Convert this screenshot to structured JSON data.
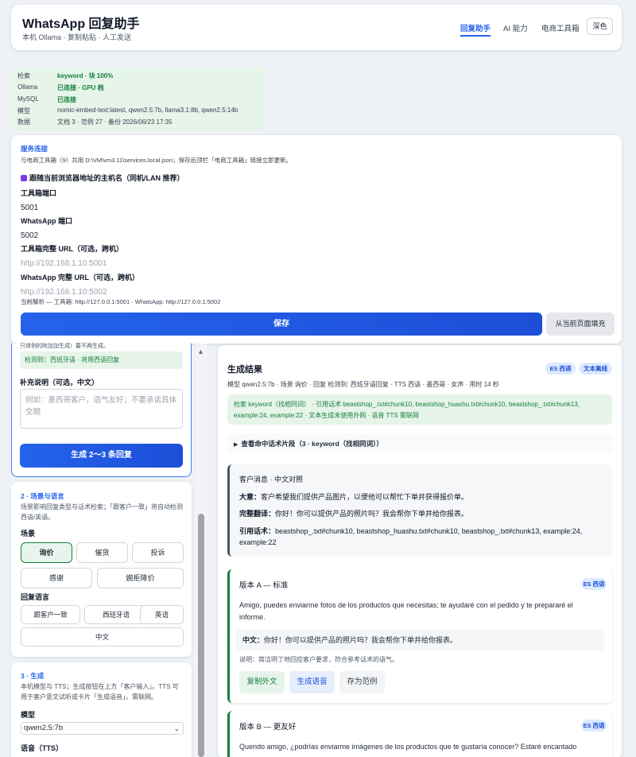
{
  "header": {
    "title": "WhatsApp 回复助手",
    "subtitle": "本机 Ollama · 复制粘贴 · 人工发送",
    "nav": [
      "回复助手",
      "AI 能力",
      "电商工具箱"
    ],
    "theme_button": "深色"
  },
  "status": {
    "rows": [
      {
        "key": "检索",
        "val": "keyword · 块 100%"
      },
      {
        "key": "Ollama",
        "val": "已连接 · GPU 档"
      },
      {
        "key": "MySQL",
        "val": "已连接"
      },
      {
        "key": "模型",
        "val": "nomic-embed-text:latest, qwen2.5:7b, llama3.1:8b, qwen2.5:14b"
      },
      {
        "key": "数据",
        "val": "文档 3 · 范例 27 · 备份 2026/06/23 17:35"
      }
    ]
  },
  "service": {
    "title": "服务连接",
    "note": "与电商工具箱（9）共用 D:\\VM\\vm3.11\\services.local.json；保存后顶栏「电商工具箱」链接立即更新。",
    "checkbox_label": "跟随当前浏览器地址的主机名（同机/LAN 推荐）",
    "toolbox_port_label": "工具箱端口",
    "toolbox_port": "5001",
    "wa_port_label": "WhatsApp 端口",
    "wa_port": "5002",
    "toolbox_url_label": "工具箱完整 URL（可选，跨机）",
    "toolbox_url_placeholder": "http://192.168.1.10:5001",
    "wa_url_label": "WhatsApp 完整 URL（可选，跨机）",
    "wa_url_placeholder": "http://192.168.1.10:5002",
    "resolved": "当前解析 — 工具箱: http://127.0.0.1:5001 · WhatsApp: http://127.0.0.1:5002",
    "save_label": "保存",
    "fill_label": "从当前页面填充"
  },
  "panel1": {
    "clipped_text": "只体例的附加加生成）要不两生成。",
    "detected": "检测到：西班牙语 · 将用西语回复",
    "note_label": "补充说明（可选，中文）",
    "note_placeholder": "例如：墨西哥客户，语气友好；不要承诺具体交期",
    "generate_label": "生成 2〜3 条回复"
  },
  "panel2": {
    "title": "2 · 场景与语言",
    "desc": "场景影响回复类型与话术检索；「跟客户一致」将自动检测西语/英语。",
    "scene_label": "场景",
    "scenes": [
      "询价",
      "催货",
      "投诉",
      "感谢",
      "婉拒降价"
    ],
    "lang_label": "回复语言",
    "langs": [
      "跟客户一致",
      "西班牙语",
      "英语",
      "中文"
    ]
  },
  "panel3": {
    "title": "3 · 生成",
    "desc": "本机模型与 TTS；生成按钮在上方「客户输入」。TTS 可用于客户意文试听或卡片「生成语音」，需联网。",
    "model_label": "模型",
    "model_value": "qwen2.5:7b",
    "tts_label": "语音（TTS）"
  },
  "results": {
    "title": "生成结果",
    "badges": [
      "ES 西语",
      "文本离线"
    ],
    "meta": "模型 qwen2.5:7b · 场景 询价 · 回复 检测到: 西班牙语回复 · TTS 西语 · 墨西哥 · 女声 · 用时 14 秒",
    "ref_line1": "检索 keyword（找相同词） · 引用话术 beastshop_.txt#chunk10, beastshop_huashu.txt#chunk10, beastshop_.txt#chunk13,",
    "ref_line2": "example:24, example:22 · 文本生成未使用外网 · 语音 TTS 需联网",
    "snippets": "查看命中话术片段（3 · keyword（找相同词））",
    "customer": {
      "title": "客户消息 · 中文对照",
      "gist_label": "大意：",
      "gist": "客户希望我们提供产品图片，以便他可以帮忙下单并获得报价单。",
      "trans_label": "完整翻译：",
      "trans": "你好！你可以提供产品的照片吗？我会帮你下单并给你报表。",
      "cited_label": "引用话术：",
      "cited1": "beastshop_.txt#chunk10, beastshop_huashu.txt#chunk10, beastshop_.txt#chunk13, example:24,",
      "cited2": "example:22"
    },
    "versionA": {
      "title": "版本 A — 标准",
      "badge": "ES 西语",
      "text1": "Amigo, puedes enviarme fotos de los productos que necesitas; te ayudaré con el pedido y te prepararé el",
      "text2": "informe.",
      "zh_label": "中文：",
      "zh": "你好！你可以提供产品的照片吗？我会帮你下单并给你报表。",
      "explain": "说明：简洁明了地回应客户要求，符合参考话术的语气。",
      "actions": [
        "复制外文",
        "生成语音",
        "存为范例"
      ]
    },
    "versionB": {
      "title": "版本 B — 更友好",
      "badge": "ES 西语",
      "text1": "Querido amigo, ¿podrías enviarme imágenes de los productos que te gustaría conocer? Estaré encantado"
    }
  }
}
